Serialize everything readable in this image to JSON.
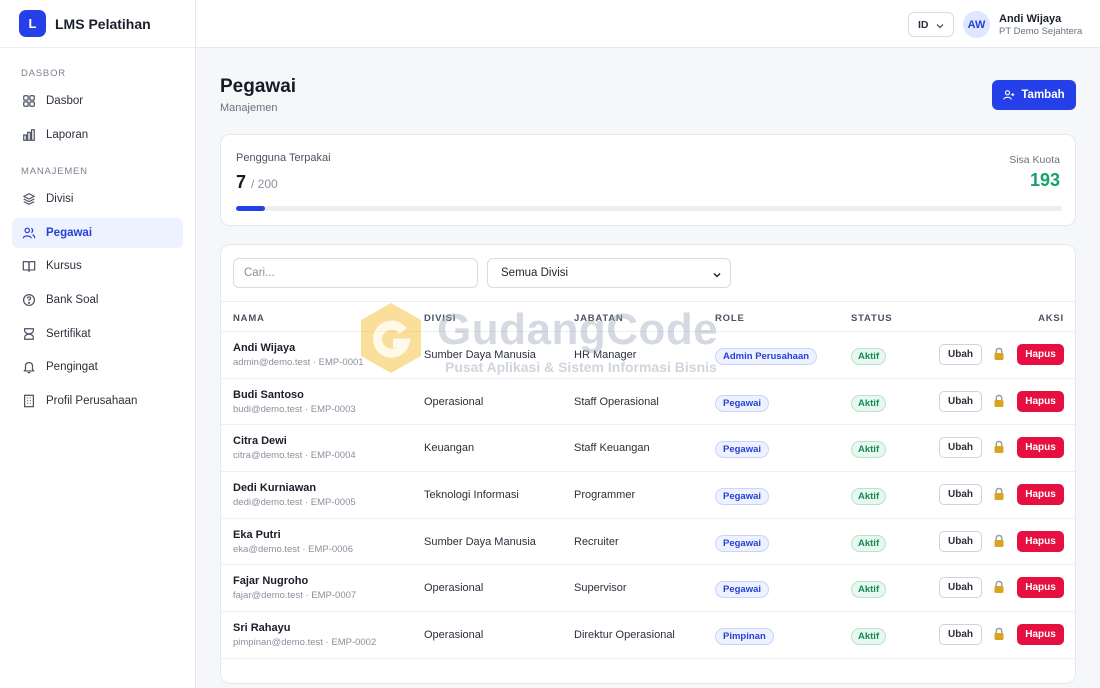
{
  "brand": {
    "logo_letter": "L",
    "name": "LMS Pelatihan"
  },
  "sidebar": {
    "sections": [
      {
        "title": "DASBOR",
        "items": [
          {
            "label": "Dasbor",
            "icon": "grid-icon"
          },
          {
            "label": "Laporan",
            "icon": "bar-chart-icon"
          }
        ]
      },
      {
        "title": "MANAJEMEN",
        "items": [
          {
            "label": "Divisi",
            "icon": "layers-icon"
          },
          {
            "label": "Pegawai",
            "icon": "users-icon",
            "active": true
          },
          {
            "label": "Kursus",
            "icon": "book-open-icon"
          },
          {
            "label": "Bank Soal",
            "icon": "help-circle-icon"
          },
          {
            "label": "Sertifikat",
            "icon": "award-icon"
          },
          {
            "label": "Pengingat",
            "icon": "bell-icon"
          },
          {
            "label": "Profil Perusahaan",
            "icon": "building-icon"
          }
        ]
      }
    ]
  },
  "topbar": {
    "language": "ID",
    "user": {
      "initials": "AW",
      "name": "Andi Wijaya",
      "company": "PT Demo Sejahtera"
    }
  },
  "page": {
    "title": "Pegawai",
    "subtitle": "Manajemen",
    "add_label": "Tambah"
  },
  "quota": {
    "used_label": "Pengguna Terpakai",
    "used": "7",
    "total": "/ 200",
    "remaining_label": "Sisa Kuota",
    "remaining": "193",
    "progress_fraction": 0.035
  },
  "filters": {
    "search_placeholder": "Cari...",
    "division_selected": "Semua Divisi"
  },
  "table": {
    "headers": {
      "name": "NAMA",
      "division": "DIVISI",
      "position": "JABATAN",
      "role": "ROLE",
      "status": "STATUS",
      "actions": "AKSI"
    },
    "edit_label": "Ubah",
    "delete_label": "Hapus",
    "rows": [
      {
        "name": "Andi Wijaya",
        "meta": "admin@demo.test · EMP-0001",
        "division": "Sumber Daya Manusia",
        "position": "HR Manager",
        "role": "Admin Perusahaan",
        "status": "Aktif"
      },
      {
        "name": "Budi Santoso",
        "meta": "budi@demo.test · EMP-0003",
        "division": "Operasional",
        "position": "Staff Operasional",
        "role": "Pegawai",
        "status": "Aktif"
      },
      {
        "name": "Citra Dewi",
        "meta": "citra@demo.test · EMP-0004",
        "division": "Keuangan",
        "position": "Staff Keuangan",
        "role": "Pegawai",
        "status": "Aktif"
      },
      {
        "name": "Dedi Kurniawan",
        "meta": "dedi@demo.test · EMP-0005",
        "division": "Teknologi Informasi",
        "position": "Programmer",
        "role": "Pegawai",
        "status": "Aktif"
      },
      {
        "name": "Eka Putri",
        "meta": "eka@demo.test · EMP-0006",
        "division": "Sumber Daya Manusia",
        "position": "Recruiter",
        "role": "Pegawai",
        "status": "Aktif"
      },
      {
        "name": "Fajar Nugroho",
        "meta": "fajar@demo.test · EMP-0007",
        "division": "Operasional",
        "position": "Supervisor",
        "role": "Pegawai",
        "status": "Aktif"
      },
      {
        "name": "Sri Rahayu",
        "meta": "pimpinan@demo.test · EMP-0002",
        "division": "Operasional",
        "position": "Direktur Operasional",
        "role": "Pimpinan",
        "status": "Aktif"
      }
    ]
  },
  "watermark": {
    "title": "GudangCode",
    "subtitle": "Pusat Aplikasi & Sistem Informasi Bisnis"
  },
  "colors": {
    "primary": "#2540e8",
    "danger": "#e5103f",
    "success": "#15a36a"
  }
}
